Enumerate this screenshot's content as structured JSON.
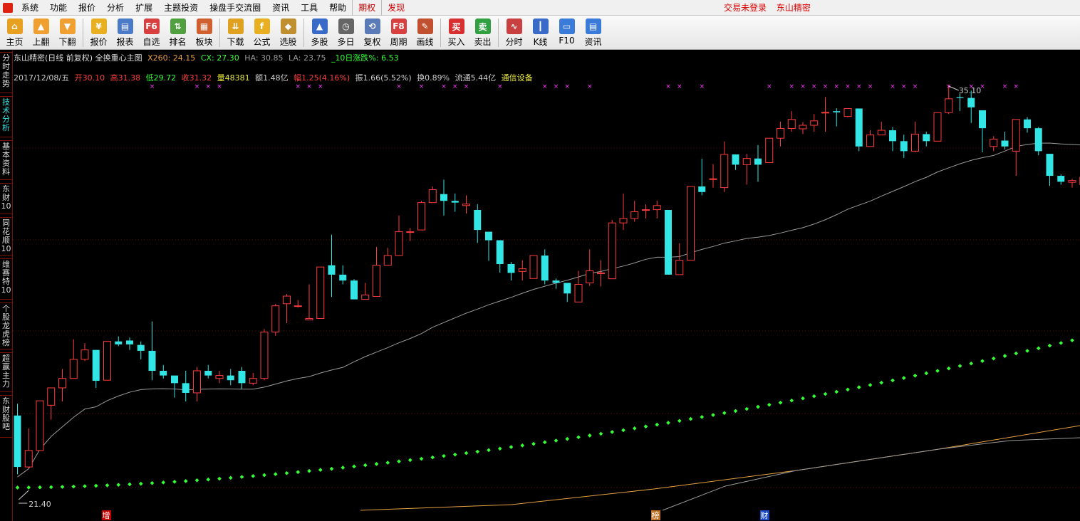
{
  "menu": {
    "items": [
      "系统",
      "功能",
      "报价",
      "分析",
      "扩展",
      "主题投资",
      "操盘手交流圈",
      "资讯",
      "工具",
      "帮助"
    ],
    "highlight": [
      "期权",
      "发现"
    ],
    "right": [
      "交易未登录",
      "东山精密"
    ]
  },
  "toolbar": [
    {
      "label": "主页",
      "icon": "home-icon",
      "color": "#e8a020"
    },
    {
      "label": "上翻",
      "icon": "arrow-up-icon",
      "color": "#f0a030"
    },
    {
      "label": "下翻",
      "icon": "arrow-down-icon",
      "color": "#f0a030"
    },
    {
      "label": "报价",
      "icon": "yen-icon",
      "color": "#e8b020"
    },
    {
      "label": "报表",
      "icon": "report-icon",
      "color": "#4a7ac8"
    },
    {
      "label": "自选",
      "icon": "f6-icon",
      "color": "#d84040"
    },
    {
      "label": "排名",
      "icon": "rank-icon",
      "color": "#50a040"
    },
    {
      "label": "板块",
      "icon": "block-icon",
      "color": "#d06030"
    },
    {
      "label": "下载",
      "icon": "download-icon",
      "color": "#e0a020"
    },
    {
      "label": "公式",
      "icon": "formula-icon",
      "color": "#e8b020"
    },
    {
      "label": "选股",
      "icon": "select-stock-icon",
      "color": "#c09030"
    },
    {
      "label": "多股",
      "icon": "multi-stock-icon",
      "color": "#3a6ac8"
    },
    {
      "label": "多日",
      "icon": "clock-icon",
      "color": "#666666"
    },
    {
      "label": "复权",
      "icon": "restore-icon",
      "color": "#5a7ab8"
    },
    {
      "label": "周期",
      "icon": "f8-icon",
      "color": "#d84040"
    },
    {
      "label": "画线",
      "icon": "draw-line-icon",
      "color": "#c05030"
    },
    {
      "label": "买入",
      "icon": "buy-icon",
      "color": "#d83030"
    },
    {
      "label": "卖出",
      "icon": "sell-icon",
      "color": "#30a040"
    },
    {
      "label": "分时",
      "icon": "timeshare-icon",
      "color": "#c84040"
    },
    {
      "label": "K线",
      "icon": "kline-icon",
      "color": "#3a6ac8"
    },
    {
      "label": "F10",
      "icon": "f10-icon",
      "color": "#3a7ad8"
    },
    {
      "label": "资讯",
      "icon": "news-icon",
      "color": "#3a7ad8"
    }
  ],
  "side_tabs": [
    {
      "label": "分时走势",
      "active": false
    },
    {
      "label": "技术分析",
      "active": true
    },
    {
      "label": "基本资料",
      "active": false
    },
    {
      "label": "东财10",
      "active": false
    },
    {
      "label": "同花顺10",
      "active": false
    },
    {
      "label": "维赛特10",
      "active": false
    },
    {
      "label": "个股龙虎榜",
      "active": false
    },
    {
      "label": "超赢主力",
      "active": false
    },
    {
      "label": "东财股吧",
      "active": false
    }
  ],
  "info": {
    "title": "东山精密(日线 前复权) 全换重心主图",
    "x260": "X260: 24.15",
    "cx": "CX: 27.30",
    "ha": "HA: 30.85",
    "la": "LA: 23.75",
    "rise10": "_10日涨跌%: 6.53",
    "date": "2017/12/08/五",
    "open": "开30.10",
    "high": "高31.38",
    "low": "低29.72",
    "close": "收31.32",
    "volume": "量48381",
    "amount": "额1.48亿",
    "change": "幅1.25(4.16%)",
    "amplitude": "振1.66(5.52%)",
    "turnover": "换0.89%",
    "float": "流通5.44亿",
    "industry": "通信设备"
  },
  "colors": {
    "up": "#ff3c3c",
    "down": "#33e6e6",
    "dots": "#33ff33",
    "marker": "#ff33ff",
    "ma_gray": "#9a9a9a",
    "ma_orange": "#e8a040"
  },
  "chart_data": {
    "type": "candlestick",
    "y_max_label": "35.10",
    "y_min_label": "21.40",
    "bottom_marks": [
      "增",
      "榜",
      "财"
    ],
    "candles": [
      [
        23.85,
        22.1,
        21.85,
        24.25
      ],
      [
        22.1,
        22.66,
        22.05,
        23.41
      ],
      [
        22.66,
        24.35,
        22.66,
        24.35
      ],
      [
        24.2,
        24.79,
        23.71,
        24.79
      ],
      [
        24.79,
        25.11,
        24.33,
        25.43
      ],
      [
        25.11,
        25.76,
        25.11,
        26.44
      ],
      [
        25.76,
        26.08,
        25.7,
        26.31
      ],
      [
        26.08,
        25.03,
        24.79,
        26.08
      ],
      [
        25.05,
        26.37,
        25.05,
        26.37
      ],
      [
        26.37,
        26.27,
        26.21,
        26.54
      ],
      [
        26.4,
        26.27,
        26.08,
        26.5
      ],
      [
        26.25,
        26.05,
        25.76,
        26.37
      ],
      [
        26.05,
        25.37,
        25.05,
        27.05
      ],
      [
        25.37,
        25.21,
        25.11,
        25.57
      ],
      [
        25.21,
        24.95,
        24.46,
        25.21
      ],
      [
        24.95,
        24.62,
        24.33,
        25.37
      ],
      [
        24.62,
        25.37,
        24.33,
        25.5
      ],
      [
        25.37,
        25.21,
        25.11,
        25.57
      ],
      [
        25.11,
        25.21,
        24.95,
        25.37
      ],
      [
        25.21,
        25.05,
        24.88,
        25.43
      ],
      [
        25.37,
        24.95,
        24.75,
        25.5
      ],
      [
        24.95,
        25.11,
        24.88,
        25.3
      ],
      [
        25.11,
        26.69,
        25.05,
        26.79
      ],
      [
        26.69,
        27.58,
        26.56,
        27.65
      ],
      [
        27.65,
        27.91,
        26.99,
        27.98
      ],
      [
        27.58,
        27.58,
        27.52,
        27.78
      ],
      [
        27.1,
        27.15,
        27.1,
        28.31
      ],
      [
        27.15,
        28.9,
        27.15,
        28.9
      ],
      [
        28.96,
        28.64,
        27.88,
        30.0
      ],
      [
        28.64,
        28.44,
        28.31,
        28.96
      ],
      [
        28.44,
        27.8,
        27.8,
        28.49
      ],
      [
        27.8,
        27.95,
        27.8,
        28.36
      ],
      [
        27.9,
        28.96,
        27.9,
        29.58
      ],
      [
        28.96,
        29.29,
        28.96,
        29.55
      ],
      [
        29.29,
        30.1,
        29.29,
        30.65
      ],
      [
        30.1,
        30.1,
        29.78,
        30.23
      ],
      [
        30.16,
        31.09,
        30.16,
        31.15
      ],
      [
        31.09,
        31.53,
        31.09,
        31.64
      ],
      [
        31.38,
        31.15,
        30.65,
        31.87
      ],
      [
        31.15,
        31.09,
        30.78,
        31.4
      ],
      [
        30.99,
        31.04,
        30.72,
        31.34
      ],
      [
        30.84,
        30.16,
        29.72,
        31.04
      ],
      [
        30.1,
        29.81,
        29.11,
        30.1
      ],
      [
        29.81,
        29.0,
        28.71,
        29.81
      ],
      [
        29.0,
        28.7,
        28.44,
        29.07
      ],
      [
        28.75,
        28.84,
        28.44,
        29.13
      ],
      [
        28.51,
        29.29,
        28.51,
        29.29
      ],
      [
        29.29,
        28.44,
        28.31,
        29.5
      ],
      [
        28.44,
        28.36,
        28.16,
        28.51
      ],
      [
        28.36,
        28.0,
        27.71,
        28.36
      ],
      [
        27.71,
        28.31,
        27.71,
        28.77
      ],
      [
        28.36,
        28.77,
        28.26,
        29.5
      ],
      [
        28.68,
        28.7,
        28.24,
        29.13
      ],
      [
        28.5,
        30.4,
        28.5,
        30.5
      ],
      [
        30.4,
        30.55,
        30.16,
        31.4
      ],
      [
        30.55,
        30.78,
        30.44,
        31.15
      ],
      [
        30.85,
        30.85,
        30.55,
        31.03
      ],
      [
        30.85,
        30.99,
        30.55,
        31.15
      ],
      [
        30.84,
        28.64,
        28.64,
        30.84
      ],
      [
        28.64,
        29.13,
        28.64,
        29.71
      ],
      [
        29.13,
        31.64,
        29.13,
        31.64
      ],
      [
        31.64,
        31.45,
        31.34,
        32.58
      ],
      [
        31.9,
        31.9,
        31.6,
        32.4
      ],
      [
        31.6,
        32.73,
        31.45,
        33.17
      ],
      [
        32.73,
        32.38,
        32.2,
        32.73
      ],
      [
        32.38,
        32.59,
        31.7,
        32.75
      ],
      [
        32.59,
        32.38,
        31.8,
        33.05
      ],
      [
        32.45,
        33.28,
        32.45,
        33.28
      ],
      [
        33.28,
        33.61,
        33.0,
        33.84
      ],
      [
        33.61,
        33.92,
        33.5,
        34.2
      ],
      [
        33.6,
        33.72,
        33.42,
        33.83
      ],
      [
        33.72,
        33.87,
        33.5,
        34.1
      ],
      [
        34.16,
        34.16,
        33.5,
        34.68
      ],
      [
        34.2,
        34.16,
        33.68,
        34.3
      ],
      [
        34.02,
        34.29,
        33.99,
        34.29
      ],
      [
        34.29,
        33.0,
        32.84,
        34.29
      ],
      [
        33.0,
        33.39,
        33.0,
        33.55
      ],
      [
        33.39,
        33.55,
        33.39,
        33.84
      ],
      [
        33.55,
        33.18,
        32.84,
        33.66
      ],
      [
        33.18,
        32.84,
        32.61,
        33.4
      ],
      [
        32.84,
        33.42,
        32.8,
        33.84
      ],
      [
        33.42,
        33.18,
        33.0,
        33.5
      ],
      [
        33.18,
        34.15,
        33.18,
        34.15
      ],
      [
        34.15,
        34.62,
        34.1,
        35.1
      ],
      [
        34.68,
        34.65,
        34.2,
        34.8
      ],
      [
        34.65,
        34.33,
        33.8,
        34.9
      ],
      [
        34.23,
        33.62,
        32.8,
        34.23
      ],
      [
        33.0,
        33.25,
        32.84,
        33.35
      ],
      [
        33.2,
        33.0,
        32.9,
        33.5
      ],
      [
        32.84,
        33.92,
        32.0,
        33.92
      ],
      [
        33.92,
        33.62,
        33.47,
        34.0
      ],
      [
        33.62,
        32.84,
        32.7,
        33.66
      ],
      [
        32.75,
        32.0,
        31.66,
        32.75
      ],
      [
        32.0,
        31.8,
        31.7,
        32.05
      ],
      [
        31.78,
        31.84,
        31.6,
        31.9
      ],
      [
        31.7,
        31.95,
        31.6,
        32.0
      ],
      [
        32.0,
        32.25,
        31.7,
        32.22
      ],
      [
        32.2,
        32.0,
        31.4,
        32.1
      ],
      [
        31.33,
        32.15,
        31.25,
        32.2
      ]
    ]
  }
}
